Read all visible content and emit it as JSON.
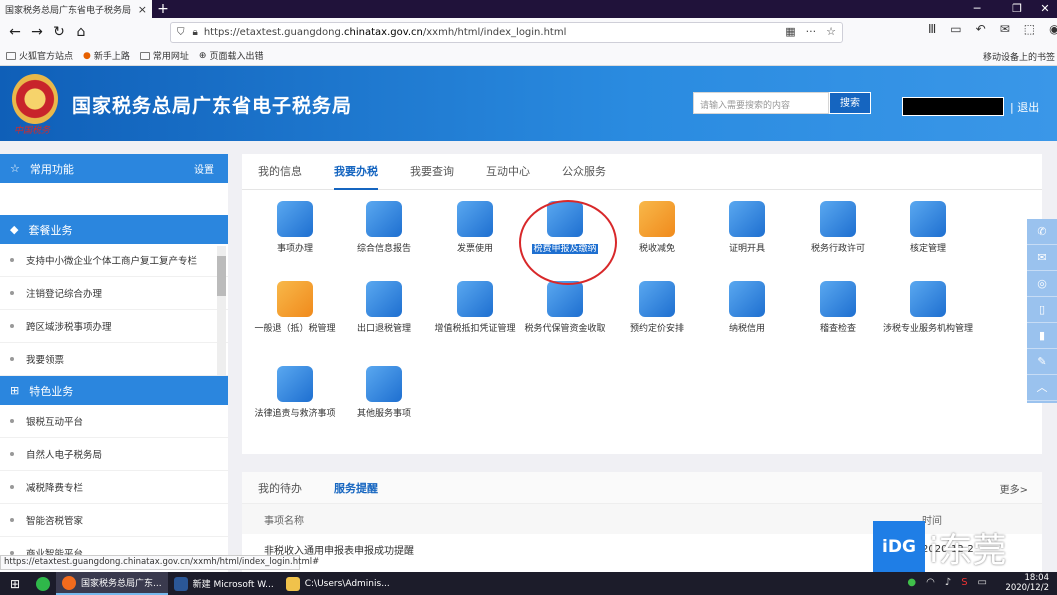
{
  "browser": {
    "tab_title": "国家税务总局广东省电子税务局",
    "url_prefix": "https://etaxtest.guangdong.",
    "url_host": "chinatax.gov.cn",
    "url_suffix": "/xxmh/html/index_login.html",
    "bookmarks": [
      "火狐官方站点",
      "新手上路",
      "常用网址",
      "页面载入出错"
    ],
    "bookmarks_right": "移动设备上的书签",
    "status_url": "https://etaxtest.guangdong.chinatax.gov.cn/xxmh/html/index_login.html#"
  },
  "header": {
    "emblem_caption": "中国税务",
    "site_title": "国家税务总局广东省电子税务局",
    "search_placeholder": "请输入需要搜索的内容",
    "search_button": "搜索",
    "logout": "| 退出"
  },
  "sidebar": {
    "common_title": "常用功能",
    "common_settings": "设置",
    "package_title": "套餐业务",
    "package_items": [
      "支持中小微企业个体工商户复工复产专栏",
      "注销登记综合办理",
      "跨区域涉税事项办理",
      "我要领票"
    ],
    "special_title": "特色业务",
    "special_items": [
      "银税互动平台",
      "自然人电子税务局",
      "减税降费专栏",
      "智能咨税管家",
      "商业智能平台"
    ]
  },
  "main": {
    "tabs": [
      "我的信息",
      "我要办税",
      "我要查询",
      "互动中心",
      "公众服务"
    ],
    "active_tab": "我要办税",
    "items": [
      {
        "label": "事项办理",
        "color": "blue"
      },
      {
        "label": "综合信息报告",
        "color": "blue"
      },
      {
        "label": "发票使用",
        "color": "blue"
      },
      {
        "label": "税费申报及缴纳",
        "color": "blue",
        "selected": true
      },
      {
        "label": "税收减免",
        "color": "orange"
      },
      {
        "label": "证明开具",
        "color": "blue"
      },
      {
        "label": "税务行政许可",
        "color": "blue"
      },
      {
        "label": "核定管理",
        "color": "blue"
      },
      {
        "label": "一般退（抵）税管理",
        "color": "orange"
      },
      {
        "label": "出口退税管理",
        "color": "blue"
      },
      {
        "label": "增值税抵扣凭证管理",
        "color": "blue"
      },
      {
        "label": "税务代保管资金收取",
        "color": "blue"
      },
      {
        "label": "预约定价安排",
        "color": "blue"
      },
      {
        "label": "纳税信用",
        "color": "blue"
      },
      {
        "label": "稽查检查",
        "color": "blue"
      },
      {
        "label": "涉税专业服务机构管理",
        "color": "blue"
      },
      {
        "label": "法律追责与救济事项",
        "color": "blue"
      },
      {
        "label": "其他服务事项",
        "color": "blue"
      }
    ]
  },
  "todo": {
    "tabs": [
      "我的待办",
      "服务提醒"
    ],
    "more": "更多>",
    "col_name": "事项名称",
    "col_time": "时间",
    "row_name": "非税收入通用申报表申报成功提醒",
    "row_date": "2020-12-2"
  },
  "watermark": {
    "logo": "iDG",
    "text": "i东莞"
  },
  "taskbar": {
    "apps": [
      "国家税务总局广东...",
      "新建 Microsoft W...",
      "C:\\Users\\Adminis..."
    ],
    "time": "18:04",
    "date": "2020/12/2"
  }
}
